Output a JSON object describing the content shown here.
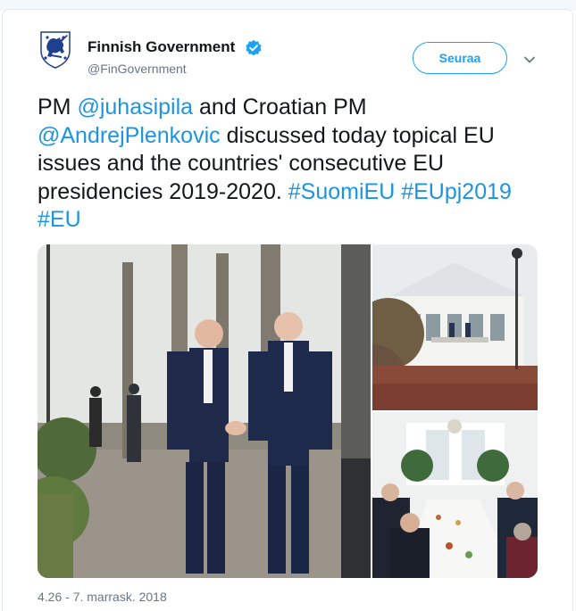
{
  "tweet": {
    "author_name": "Finnish Government",
    "handle": "@FinGovernment",
    "follow_label": "Seuraa",
    "text": [
      {
        "t": "PM ",
        "link": false
      },
      {
        "t": "@juhasipila",
        "link": true
      },
      {
        "t": " and Croatian PM ",
        "link": false
      },
      {
        "t": "@AndrejPlenkovic",
        "link": true
      },
      {
        "t": " discussed today topical EU issues and the countries' consecutive EU presidencies 2019-2020. ",
        "link": false
      },
      {
        "t": "#SuomiEU",
        "link": true
      },
      {
        "t": " ",
        "link": false
      },
      {
        "t": "#EUpj2019",
        "link": true
      },
      {
        "t": " ",
        "link": false
      },
      {
        "t": "#EU",
        "link": true
      }
    ],
    "timestamp": "4.26 - 7. marrask. 2018"
  },
  "icons": {
    "avatar": "finnish-lion-coat-of-arms-icon",
    "verified": "verified-badge-icon",
    "caret": "chevron-down-icon"
  },
  "colors": {
    "accent": "#1da1f2",
    "link": "#1b95e0",
    "secondary_text": "#657786",
    "coat_of_arms_blue": "#1f3f8f"
  }
}
